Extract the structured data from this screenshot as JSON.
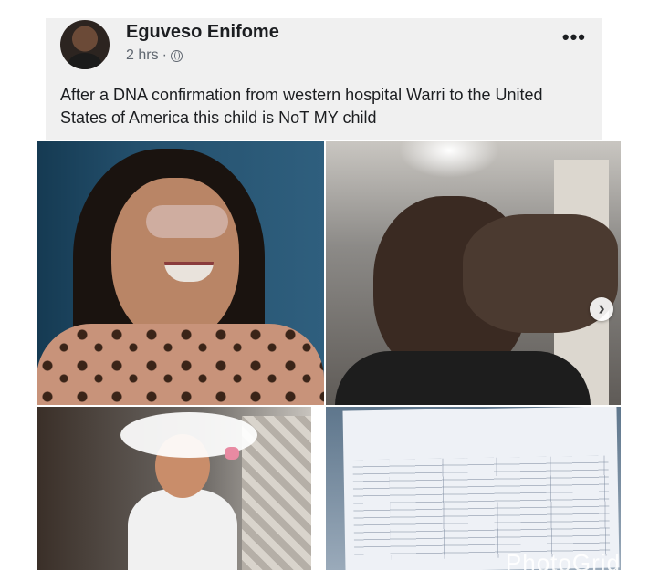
{
  "post": {
    "author": "Eguveso Enifome",
    "time": "2 hrs",
    "separator": "·",
    "more_label": "•••",
    "text": "After a DNA confirmation from western hospital Warri to the United States of America this child is NoT MY child"
  },
  "photos": {
    "next_label": "›",
    "watermark": "PhotoGrid"
  },
  "colors": {
    "card_bg": "#f0f0f0",
    "text": "#1c1e21",
    "meta": "#606770"
  }
}
